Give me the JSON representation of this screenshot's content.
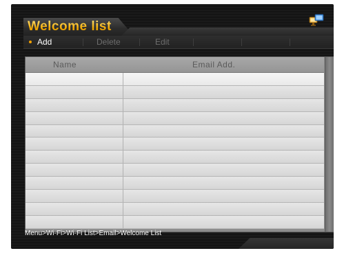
{
  "header": {
    "title": "Welcome list"
  },
  "menu": {
    "items": [
      {
        "label": "Add"
      },
      {
        "label": "Delete"
      },
      {
        "label": "Edit"
      }
    ]
  },
  "table": {
    "columns": [
      "Name",
      "Email Add."
    ],
    "rows": [
      {
        "name": "",
        "email": ""
      },
      {
        "name": "",
        "email": ""
      },
      {
        "name": "",
        "email": ""
      },
      {
        "name": "",
        "email": ""
      },
      {
        "name": "",
        "email": ""
      },
      {
        "name": "",
        "email": ""
      },
      {
        "name": "",
        "email": ""
      },
      {
        "name": "",
        "email": ""
      },
      {
        "name": "",
        "email": ""
      },
      {
        "name": "",
        "email": ""
      },
      {
        "name": "",
        "email": ""
      },
      {
        "name": "",
        "email": ""
      }
    ]
  },
  "footer": {
    "breadcrumb": "Menu>Wi-Fi>Wi-Fi List>Email>Welcome List"
  },
  "icons": {
    "status": "monitor-network-icon"
  },
  "colors": {
    "accent": "#f2a100",
    "title_gold": "#ffd25a",
    "background": "#1a1a1a"
  }
}
